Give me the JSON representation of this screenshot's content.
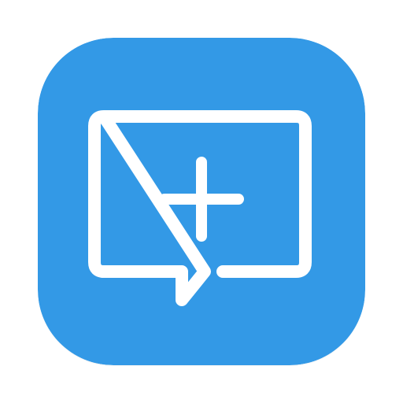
{
  "icon": {
    "name": "new-message-app-icon",
    "glyph": "speech-bubble-with-plus",
    "colors": {
      "page_background": "#ffffff",
      "tile_background": "#3399e6",
      "glyph": "#ffffff"
    }
  }
}
